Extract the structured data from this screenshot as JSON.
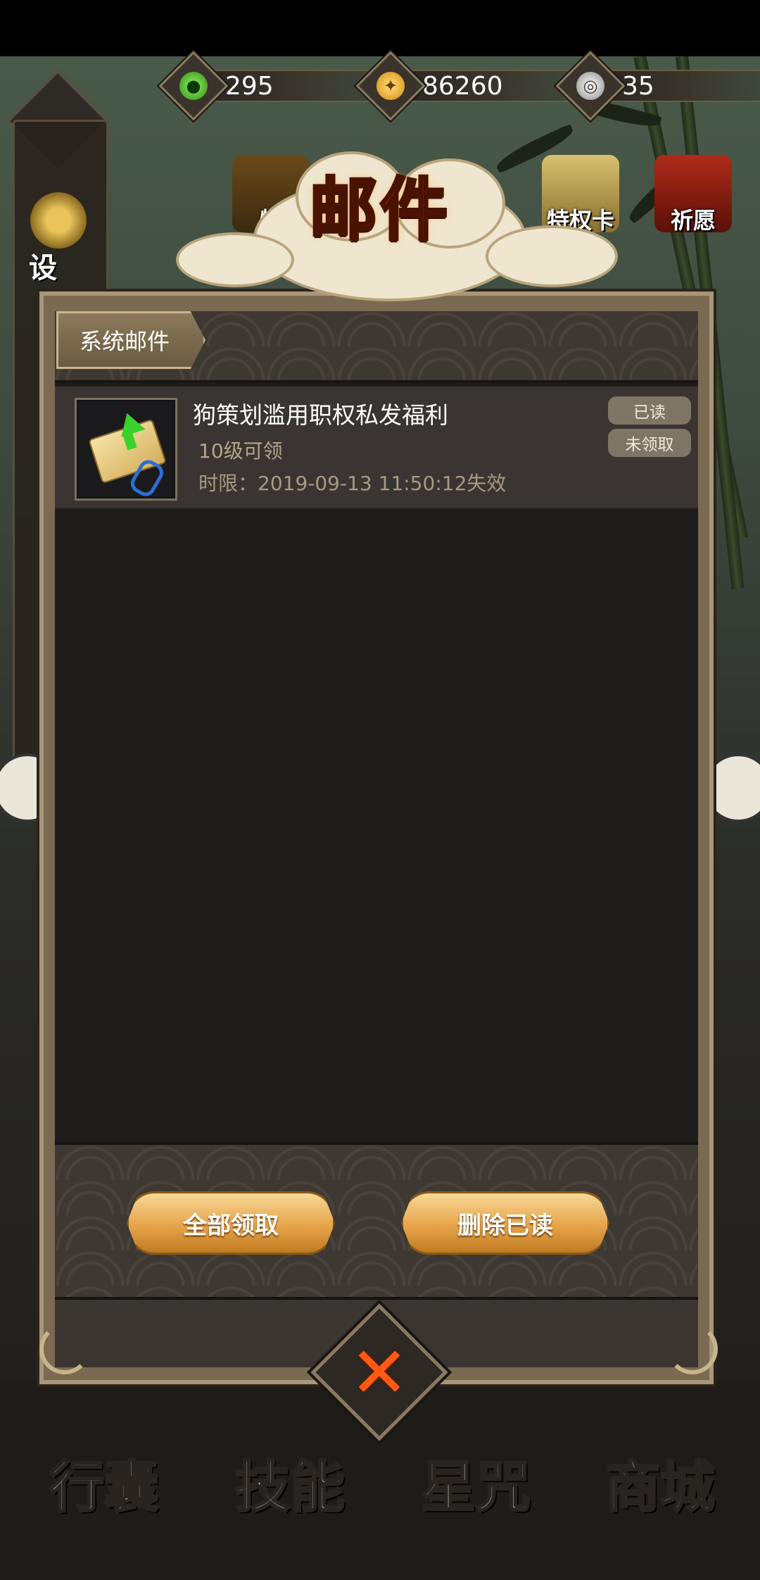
{
  "resources": [
    {
      "name": "jade",
      "icon": "jade-icon",
      "value": "295",
      "color": "#3ad12a"
    },
    {
      "name": "gold",
      "icon": "gold-coin-icon",
      "value": "86260",
      "color": "#f2a21a"
    },
    {
      "name": "silver",
      "icon": "silver-coin-icon",
      "value": "35",
      "color": "#c8c8c8"
    }
  ],
  "top_menu": {
    "items": [
      "特",
      "特权卡",
      "祈愿"
    ],
    "side_label": "设"
  },
  "window": {
    "title": "邮件",
    "tab": "系统邮件"
  },
  "mails": [
    {
      "title": "狗策划滥用职权私发福利",
      "requirement": "10级可领",
      "expiry": "时限：2019-09-13 11:50:12失效",
      "status_read": "已读",
      "status_claim": "未领取"
    }
  ],
  "buttons": {
    "claim_all": "全部领取",
    "delete_read": "删除已读"
  },
  "bottom_menu": [
    "行囊",
    "技能",
    "星咒",
    "商城"
  ],
  "colors": {
    "title": "#d8320a",
    "button": "#e6a44a",
    "panel_bg": "#1e1b1b"
  }
}
